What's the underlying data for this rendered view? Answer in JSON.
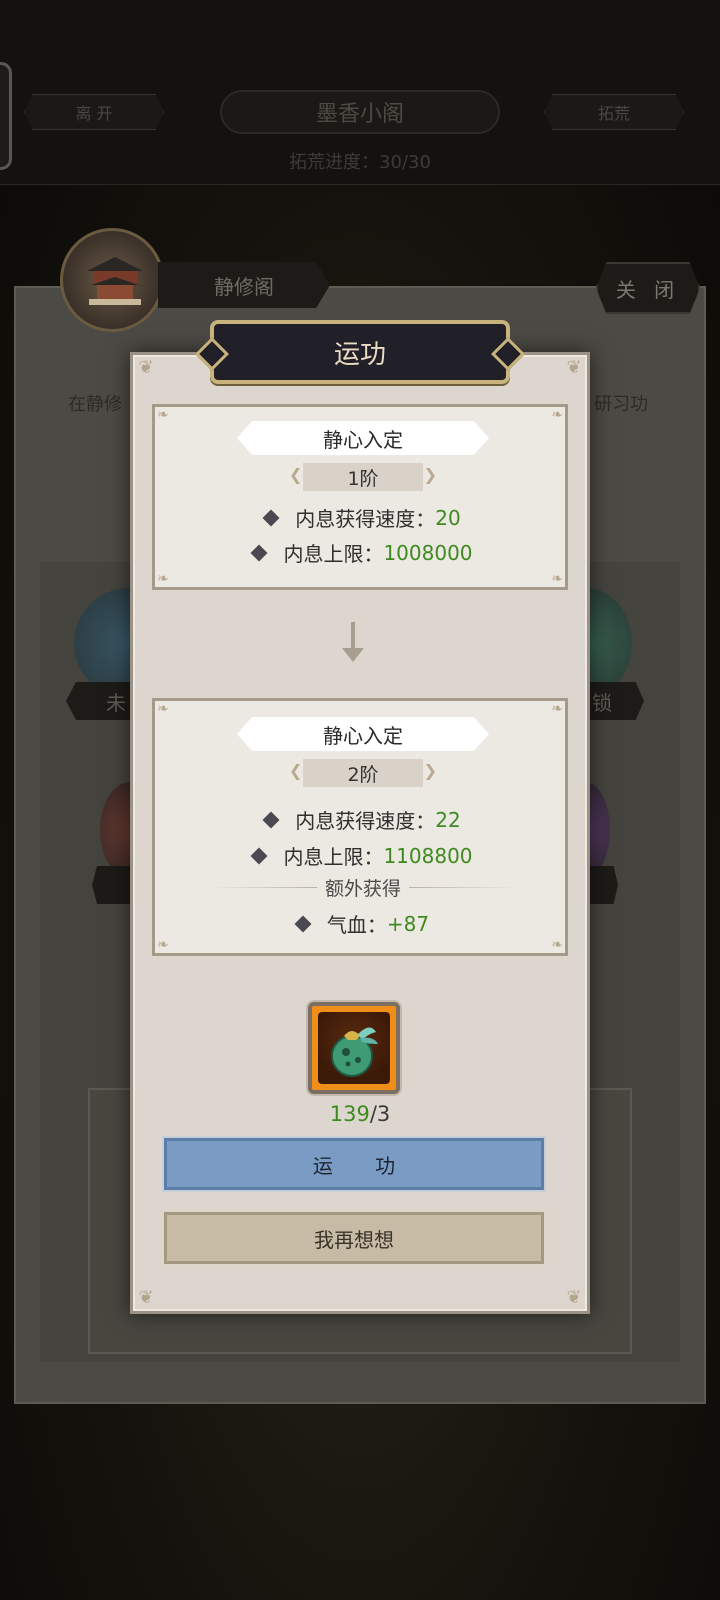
{
  "top": {
    "leave_label": "离 开",
    "location_title": "墨香小阁",
    "explore_label": "拓荒",
    "progress_text": "拓荒进度：30/30"
  },
  "back_panel": {
    "hall_name": "静修阁",
    "close_label": "关 闭",
    "desc_left": "在静修",
    "desc_right": "研习功",
    "orb_labels": [
      "未",
      "锁"
    ]
  },
  "dialog": {
    "title": "运功",
    "current": {
      "skill_name": "静心入定",
      "level": "1阶",
      "stats": [
        {
          "label": "内息获得速度：",
          "value": "20"
        },
        {
          "label": "内息上限：",
          "value": "1008000"
        }
      ]
    },
    "next": {
      "skill_name": "静心入定",
      "level": "2阶",
      "stats": [
        {
          "label": "内息获得速度：",
          "value": "22"
        },
        {
          "label": "内息上限：",
          "value": "1108800"
        }
      ],
      "extra_title": "额外获得",
      "extra_stats": [
        {
          "label": "气血：",
          "value": "+87"
        }
      ]
    },
    "cost": {
      "item_icon": "jade-pouch-icon",
      "have": "139",
      "need": "/3"
    },
    "confirm_label": "运 功",
    "cancel_label": "我再想想"
  },
  "colors": {
    "value_green": "#3e8a20",
    "confirm_blue": "#7a9cc4",
    "cancel_tan": "#c8bba5",
    "title_gold": "#c8b37c"
  }
}
